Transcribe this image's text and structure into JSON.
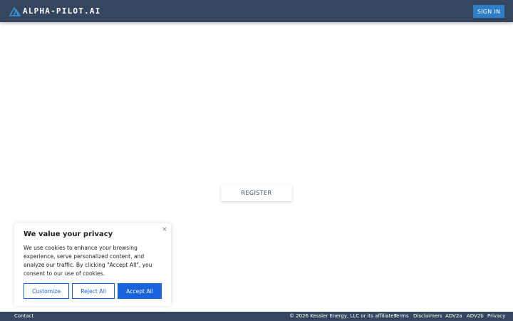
{
  "header": {
    "logo_text": "ALPHA-PILOT.AI",
    "signin_label": "SIGN IN"
  },
  "main": {
    "register_label": "REGISTER"
  },
  "cookie_banner": {
    "title": "We value your privacy",
    "body": "We use cookies to enhance your browsing experience, serve personalized content, and analyze our traffic. By clicking \"Accept All\", you consent to our use of cookies.",
    "close_glyph": "×",
    "customize_label": "Customize",
    "reject_label": "Reject All",
    "accept_label": "Accept All"
  },
  "footer": {
    "contact": "Contact",
    "copyright": "© 2026 Kessler Energy, LLC or its affiliates.",
    "links": [
      "Terms",
      "Disclaimers",
      "ADV2a",
      "ADV2b",
      "Privacy"
    ]
  },
  "colors": {
    "header_bg": "#34475e",
    "signin_bg": "#2e7dc7",
    "logo_accent": "#3b8fd9",
    "cookie_accent": "#1863dc"
  }
}
